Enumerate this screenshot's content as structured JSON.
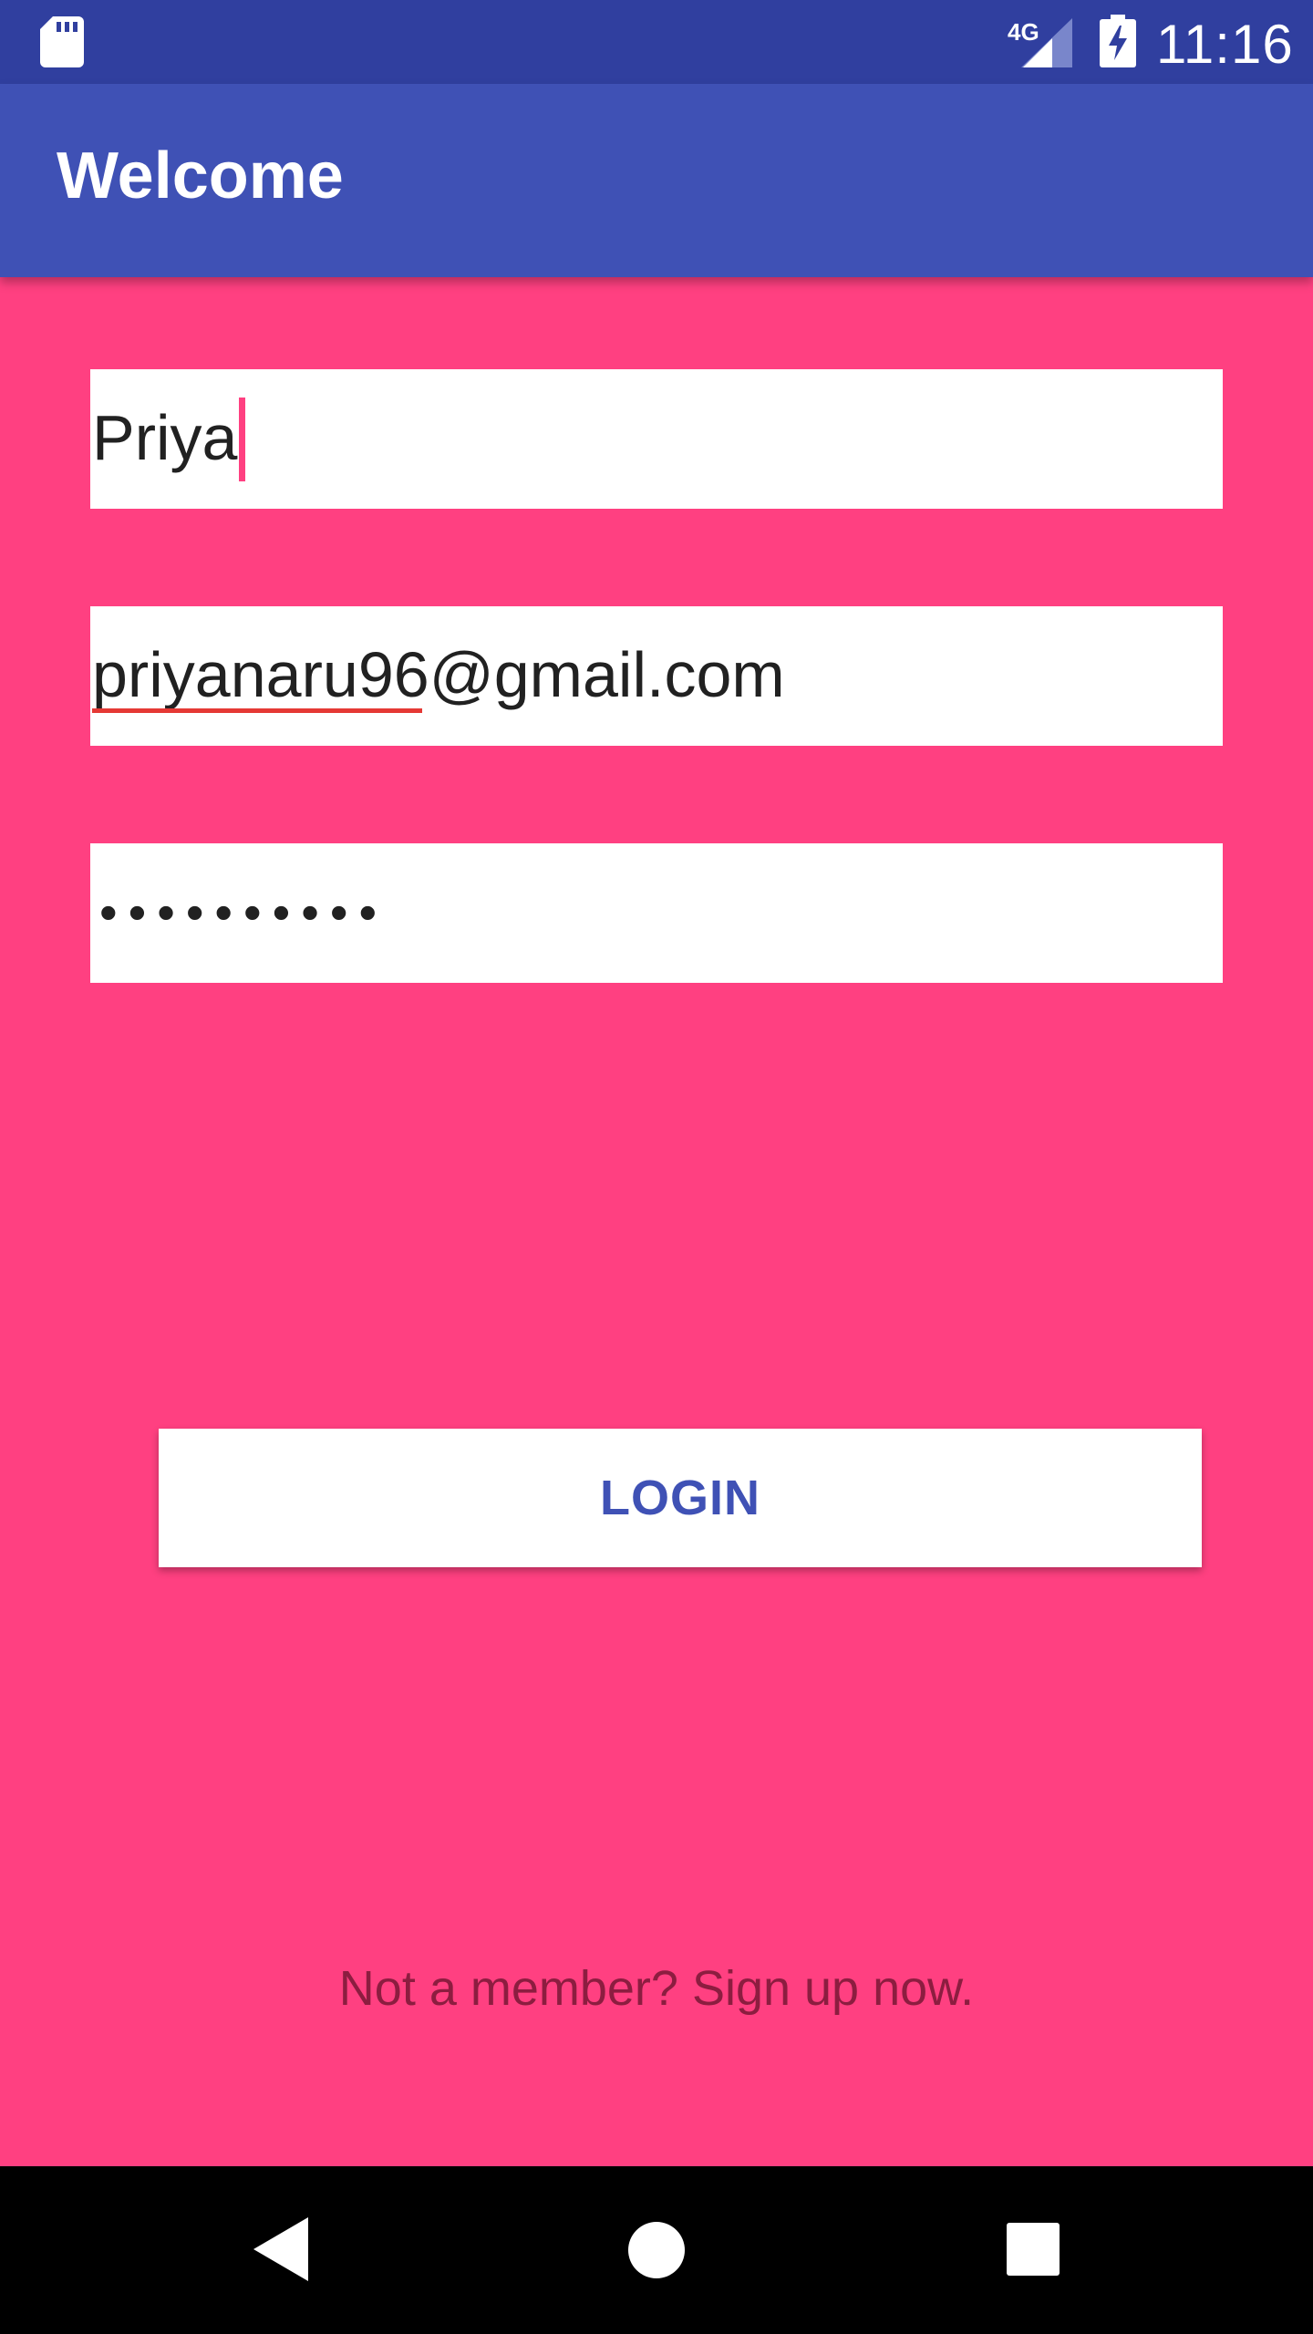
{
  "status_bar": {
    "network": "4G",
    "time": "11:16",
    "icons": [
      "sd-card-icon",
      "signal-icon",
      "battery-charging-icon"
    ]
  },
  "app_bar": {
    "title": "Welcome"
  },
  "form": {
    "name_value": "Priya",
    "email_value": "priyanaru96@gmail.com",
    "password_masked": "••••••••••"
  },
  "login_button": {
    "label": "LOGIN"
  },
  "signup_link": "Not a member? Sign up now.",
  "nav_bar": {
    "icons": [
      "back-icon",
      "home-icon",
      "recents-icon"
    ]
  },
  "colors": {
    "status_bar": "#303f9f",
    "app_bar": "#3f51b5",
    "background": "#ff4081",
    "accent": "#ff4081",
    "button_text": "#3f51b5",
    "link_text": "#8c1d40"
  }
}
